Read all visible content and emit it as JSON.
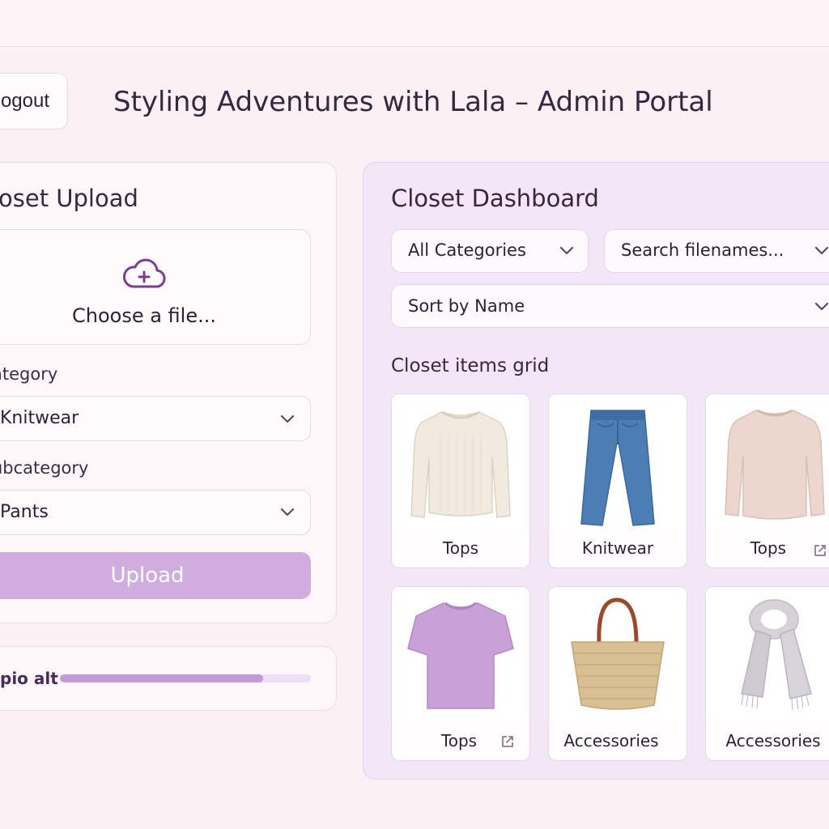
{
  "header": {
    "logout_label": "ogout",
    "title": "Styling Adventures with Lala – Admin Portal"
  },
  "upload": {
    "title": "oset Upload",
    "dropzone_text": "Choose a file...",
    "category_label": "ategory",
    "category_value": "Knitwear",
    "subcategory_label": "ubcategory",
    "subcategory_value": "Pants",
    "button_label": "Upload",
    "progress_label": "pio alt",
    "progress_fraction": 0.81
  },
  "dashboard": {
    "title": "Closet Dashboard",
    "category_filter": "All Categories",
    "search_placeholder": "Search filenames...",
    "sort_label": "Sort by Name",
    "grid_heading": "Closet items grid",
    "items": [
      {
        "label": "Tops",
        "image": "cream-sweater"
      },
      {
        "label": "Knitwear",
        "image": "blue-jeans"
      },
      {
        "label": "Tops",
        "image": "pink-sweater"
      },
      {
        "label": "Tops",
        "image": "lilac-tshirt"
      },
      {
        "label": "Accessories",
        "image": "straw-tote"
      },
      {
        "label": "Accessories",
        "image": "grey-scarf"
      }
    ]
  },
  "colors": {
    "accent": "#cfaedf",
    "accent_dark": "#7a3f8e",
    "background": "#fbf1f5",
    "dashboard_bg": "#f3e6f6"
  },
  "icons": {
    "upload": "cloud-upload-icon",
    "dropdown": "chevron-down-icon",
    "open": "external-link-icon"
  }
}
